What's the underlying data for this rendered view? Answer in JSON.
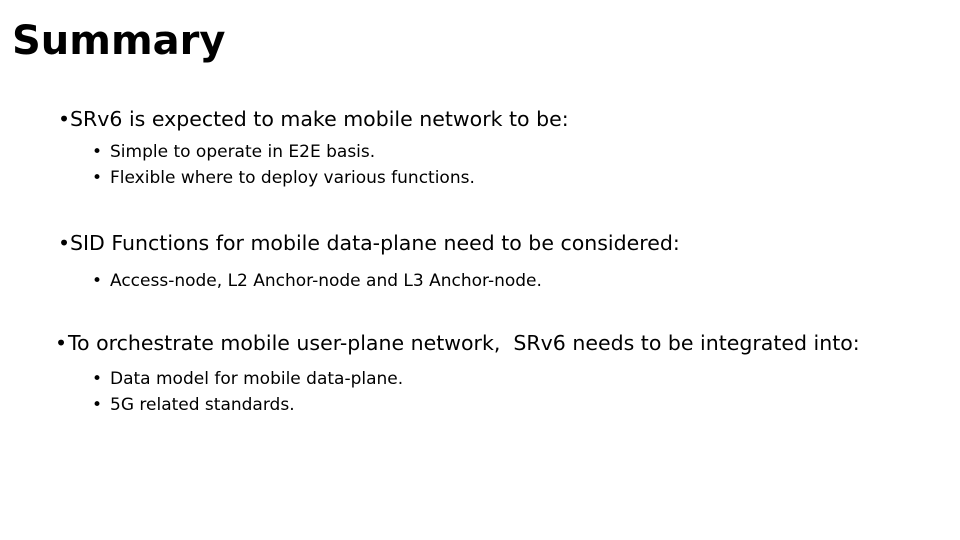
{
  "slide": {
    "title": "Summary",
    "background_color": "#ffffff",
    "text_color": "#000000",
    "bullet_glyph": "•",
    "sections": [
      {
        "level1": "SRv6 is expected to make mobile network to be:",
        "level2": [
          "Simple to operate in E2E basis.",
          "Flexible where to deploy various functions."
        ]
      },
      {
        "level1": "SID Functions for mobile data-plane need to be considered:",
        "level2": [
          "Access-node, L2 Anchor-node and L3 Anchor-node."
        ]
      },
      {
        "level1": "To orchestrate mobile user-plane network,  SRv6 needs to be integrated into:",
        "level2": [
          "Data model for mobile data-plane.",
          "5G related standards."
        ]
      }
    ]
  }
}
